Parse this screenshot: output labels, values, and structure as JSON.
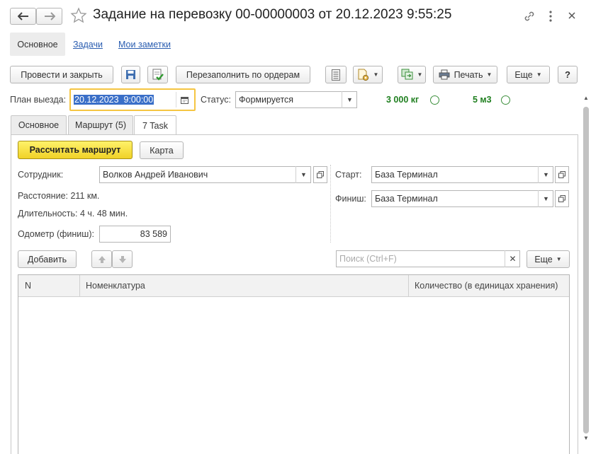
{
  "window": {
    "title": "Задание на перевозку 00-00000003 от 20.12.2023 9:55:25"
  },
  "nav": {
    "items": [
      {
        "label": "Основное"
      },
      {
        "label": "Задачи"
      },
      {
        "label": "Мои заметки"
      }
    ]
  },
  "toolbar": {
    "post_close": "Провести и закрыть",
    "refill": "Перезаполнить по ордерам",
    "print": "Печать",
    "more": "Еще",
    "help": "?"
  },
  "header": {
    "plan_label": "План выезда:",
    "plan_value": "20.12.2023  9:00:00",
    "status_label": "Статус:",
    "status_value": "Формируется",
    "weight": "3 000 кг",
    "volume": "5 м3"
  },
  "tabs": [
    {
      "label": "Основное"
    },
    {
      "label": "Маршрут (5)"
    },
    {
      "label": "7 Task"
    }
  ],
  "task": {
    "calc_button": "Рассчитать маршрут",
    "map_button": "Карта",
    "employee_label": "Сотрудник:",
    "employee_value": "Волков Андрей Иванович",
    "distance": "Расстояние: 211 км.",
    "duration": "Длительность: 4 ч. 48 мин.",
    "odometer_label": "Одометр (финиш):",
    "odometer_value": "83 589",
    "start_label": "Старт:",
    "start_value": "База Терминал",
    "finish_label": "Финиш:",
    "finish_value": "База Терминал"
  },
  "table_toolbar": {
    "add": "Добавить",
    "search_placeholder": "Поиск (Ctrl+F)",
    "more": "Еще"
  },
  "table": {
    "columns": [
      "N",
      "Номенклатура",
      "Количество (в единицах хранения)"
    ],
    "rows": []
  }
}
